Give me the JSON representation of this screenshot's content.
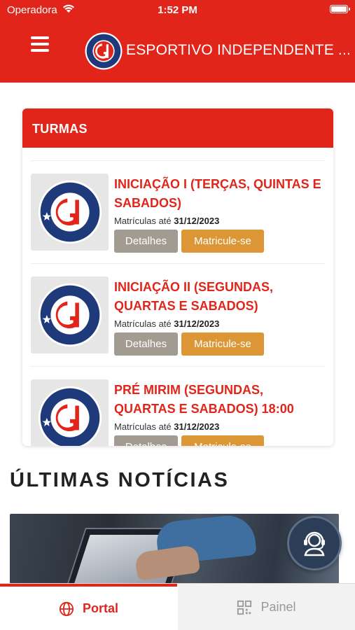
{
  "status_bar": {
    "carrier": "Operadora",
    "time": "1:52 PM"
  },
  "header": {
    "title": "ESPORTIVO INDEPENDENTE ...",
    "logo_top_text": "ESPORTIVO",
    "logo_bottom_text": "INDEPENDENTE",
    "logo_year": "2019"
  },
  "colors": {
    "brand_red": "#e1251b",
    "details_button": "#a29b91",
    "enroll_button": "#dd9636",
    "logo_navy": "#1f3a7a"
  },
  "turmas": {
    "heading": "TURMAS",
    "date_prefix": "Matrículas até",
    "details_label": "Detalhes",
    "enroll_label": "Matricule-se",
    "items": [
      {
        "name": "INICIAÇÃO I (TERÇAS, QUINTAS E SABADOS)",
        "date": "31/12/2023"
      },
      {
        "name": "INICIAÇÃO II (SEGUNDAS, QUARTAS E SABADOS)",
        "date": "31/12/2023"
      },
      {
        "name": "PRÉ MIRIM (SEGUNDAS, QUARTAS E SABADOS) 18:00",
        "date": "31/12/2023"
      }
    ]
  },
  "news": {
    "heading": "ÚLTIMAS NOTÍCIAS"
  },
  "support": {
    "icon": "headset-icon"
  },
  "tabs": [
    {
      "label": "Portal",
      "icon": "globe-icon",
      "active": true
    },
    {
      "label": "Painel",
      "icon": "dashboard-icon",
      "active": false
    }
  ]
}
